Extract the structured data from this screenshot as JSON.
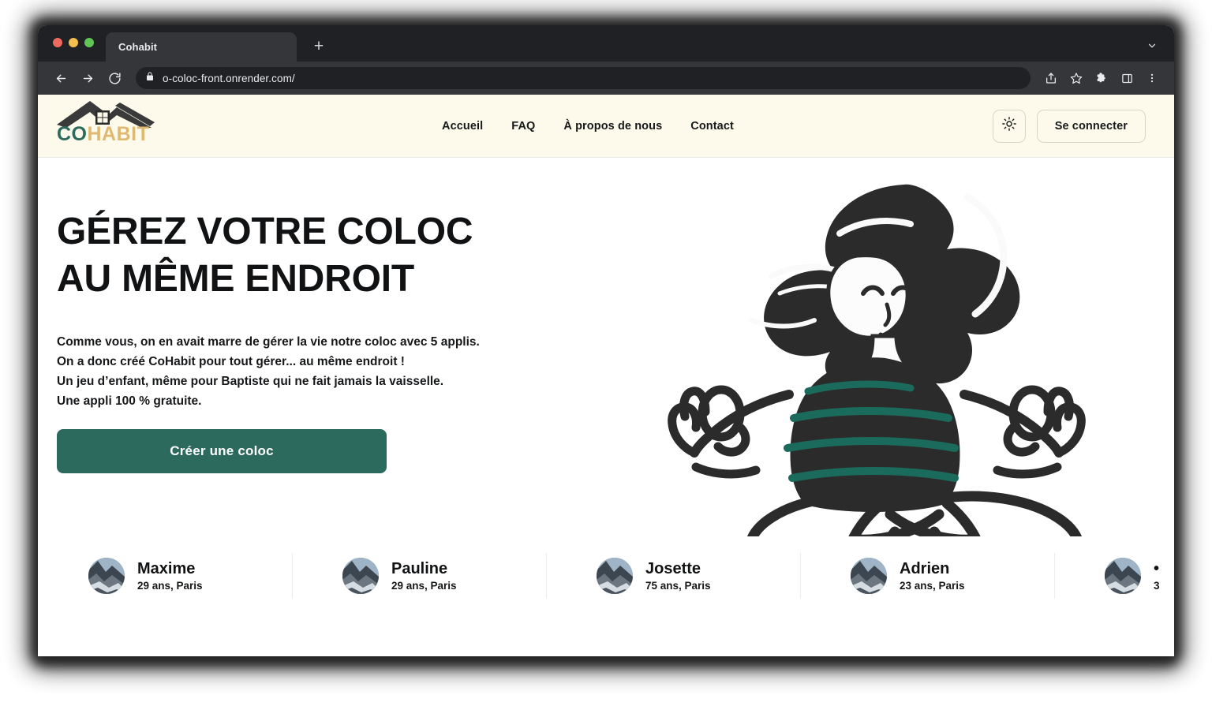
{
  "browser": {
    "tab_title": "Cohabit",
    "new_tab_label": "+",
    "url": "o-coloc-front.onrender.com/",
    "icons": {
      "back": "back-arrow-icon",
      "forward": "forward-arrow-icon",
      "reload": "reload-icon",
      "lock": "lock-icon",
      "share": "share-icon",
      "bookmark": "star-icon",
      "extensions": "puzzle-icon",
      "sidepanel": "side-panel-icon",
      "menu": "three-dot-menu-icon",
      "tab_search": "chevron-down-icon"
    },
    "traffic_lights": [
      "close",
      "minimize",
      "maximize"
    ]
  },
  "site": {
    "logo": {
      "part1": "CO",
      "part2": "HABIT",
      "color1": "#2d6a5e",
      "color2": "#e0b970"
    },
    "nav": [
      {
        "label": "Accueil"
      },
      {
        "label": "FAQ"
      },
      {
        "label": "À propos de nous"
      },
      {
        "label": "Contact"
      }
    ],
    "theme_toggle_icon": "sun-icon",
    "signin_label": "Se connecter",
    "header_bg": "#fdfaec"
  },
  "hero": {
    "title_line1": "GÉREZ VOTRE COLOC",
    "title_line2": "AU MÊME ENDROIT",
    "paragraph": [
      "Comme vous, on en avait marre de gérer la vie notre coloc avec 5 applis.",
      "On a donc créé CoHabit pour tout gérer... au même endroit !",
      "Un jeu d’enfant, même pour Baptiste qui ne fait jamais la vaisselle.",
      "Une appli 100 % gratuite."
    ],
    "cta_label": "Créer une coloc",
    "cta_color": "#2d6a5e",
    "illustration": "meditating-person-illustration"
  },
  "profiles": [
    {
      "name": "Maxime",
      "meta": "29 ans, Paris"
    },
    {
      "name": "Pauline",
      "meta": "29 ans, Paris"
    },
    {
      "name": "Josette",
      "meta": "75 ans, Paris"
    },
    {
      "name": "Adrien",
      "meta": "23 ans, Paris"
    },
    {
      "name": "•",
      "meta": "3"
    }
  ]
}
